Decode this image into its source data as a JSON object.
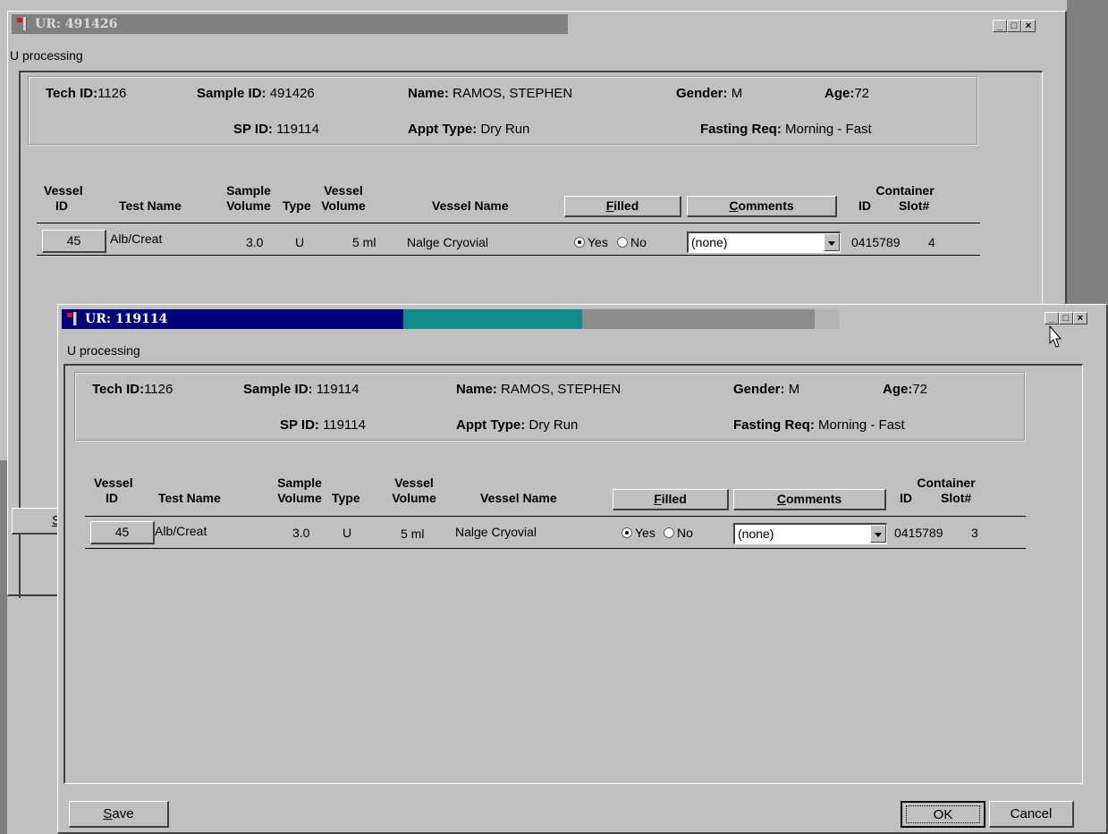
{
  "back_window": {
    "title": "UR: 491426",
    "subtitle": "U processing",
    "info": {
      "tech_id_label": "Tech ID:",
      "tech_id": "1126",
      "sample_id_label": "Sample ID:",
      "sample_id": "491426",
      "name_label": "Name:",
      "name": "RAMOS, STEPHEN",
      "gender_label": "Gender:",
      "gender": "M",
      "age_label": "Age:",
      "age": "72",
      "sp_id_label": "SP ID:",
      "sp_id": "119114",
      "appt_type_label": "Appt Type:",
      "appt_type": "Dry Run",
      "fasting_label": "Fasting Req:",
      "fasting": "Morning - Fast"
    },
    "row": {
      "vessel_id": "45",
      "test_name": "Alb/Creat",
      "sample_volume": "3.0",
      "type": "U",
      "vessel_volume": "5 ml",
      "vessel_name": "Nalge Cryovial",
      "yes": "Yes",
      "no": "No",
      "comment": "(none)",
      "container_id": "0415789",
      "slot": "4"
    }
  },
  "front_window": {
    "title": "UR: 119114",
    "subtitle": "U processing",
    "info": {
      "tech_id_label": "Tech ID:",
      "tech_id": "1126",
      "sample_id_label": "Sample ID:",
      "sample_id": "119114",
      "name_label": "Name:",
      "name": "RAMOS, STEPHEN",
      "gender_label": "Gender:",
      "gender": "M",
      "age_label": "Age:",
      "age": "72",
      "sp_id_label": "SP ID:",
      "sp_id": "119114",
      "appt_type_label": "Appt Type:",
      "appt_type": "Dry Run",
      "fasting_label": "Fasting Req:",
      "fasting": "Morning - Fast"
    },
    "row": {
      "vessel_id": "45",
      "test_name": "Alb/Creat",
      "sample_volume": "3.0",
      "type": "U",
      "vessel_volume": "5 ml",
      "vessel_name": "Nalge Cryovial",
      "yes": "Yes",
      "no": "No",
      "comment": "(none)",
      "container_id": "0415789",
      "slot": "3"
    },
    "buttons": {
      "save_rest": "ave",
      "save_first": "S",
      "ok": "OK",
      "cancel": "Cancel"
    }
  },
  "columns": {
    "vessel": "Vessel",
    "id": "ID",
    "test_name": "Test Name",
    "sample": "Sample",
    "volume": "Volume",
    "type": "Type",
    "vessel_name": "Vessel Name",
    "filled_first": "F",
    "filled_rest": "illed",
    "comments_first": "C",
    "comments_rest": "omments",
    "container": "Container",
    "slot": "Slot#"
  },
  "window_buttons": {
    "minimize": "_",
    "maximize": "□",
    "close": "×"
  },
  "back_footer_fragment": "S"
}
